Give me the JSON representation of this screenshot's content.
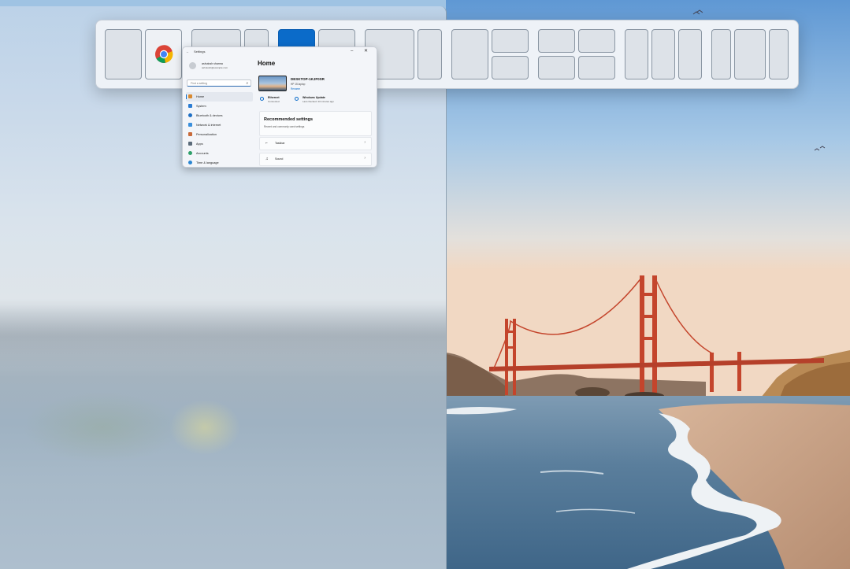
{
  "snap_layouts": {
    "groups": [
      {
        "name": "half-half",
        "zones": [
          "left",
          "right"
        ]
      },
      {
        "name": "two-thirds-one-third",
        "zones": [
          "left",
          "right"
        ]
      },
      {
        "name": "one-third-two-thirds",
        "zones": [
          "left",
          "right"
        ],
        "active_zone": 0
      },
      {
        "name": "two-thirds-one-third-b",
        "zones": [
          "left",
          "right"
        ]
      },
      {
        "name": "half-quarters",
        "zones": [
          "left",
          "top-right",
          "bottom-right"
        ]
      },
      {
        "name": "quad",
        "zones": [
          "top-left",
          "top-right",
          "bottom-left",
          "bottom-right"
        ]
      },
      {
        "name": "thirds",
        "zones": [
          "left",
          "center",
          "right"
        ]
      },
      {
        "name": "quarter-half-quarter",
        "zones": [
          "left",
          "center",
          "right"
        ]
      }
    ],
    "occupied_app_icon": "chrome-icon",
    "active_color": "#0b6bc9"
  },
  "settings_window": {
    "title": "Settings",
    "back_glyph": "←",
    "window_controls": "–  ✕",
    "user": {
      "name": "ashutosh sharma",
      "email": "ashutosh@example.com"
    },
    "search_placeholder": "Find a setting",
    "search_glyph": "⌕",
    "nav": [
      {
        "label": "Home",
        "selected": true,
        "color": "#d9892f"
      },
      {
        "label": "System",
        "color": "#2b7cd3"
      },
      {
        "label": "Bluetooth & devices",
        "color": "#1f6fc4"
      },
      {
        "label": "Network & internet",
        "color": "#3a8fdc"
      },
      {
        "label": "Personalization",
        "color": "#c86a3a"
      },
      {
        "label": "Apps",
        "color": "#5b6b7a"
      },
      {
        "label": "Accounts",
        "color": "#2fa06a"
      },
      {
        "label": "Time & language",
        "color": "#2a86d1"
      }
    ],
    "page_title": "Home",
    "device": {
      "name": "DESKTOP-1KJF0SR",
      "model": "HP 15 laptop",
      "rename": "Rename"
    },
    "status": [
      {
        "label": "Ethernet",
        "value": "Connected"
      },
      {
        "label": "Windows Update",
        "value": "Last checked: 43 minutes ago"
      }
    ],
    "recommended": {
      "title": "Recommended settings",
      "subtitle": "Recent and commonly used settings",
      "rows": [
        {
          "icon": "⌐",
          "label": "Taskbar",
          "chevron": "›"
        },
        {
          "icon": "♫",
          "label": "Sound",
          "chevron": "›"
        }
      ]
    }
  }
}
